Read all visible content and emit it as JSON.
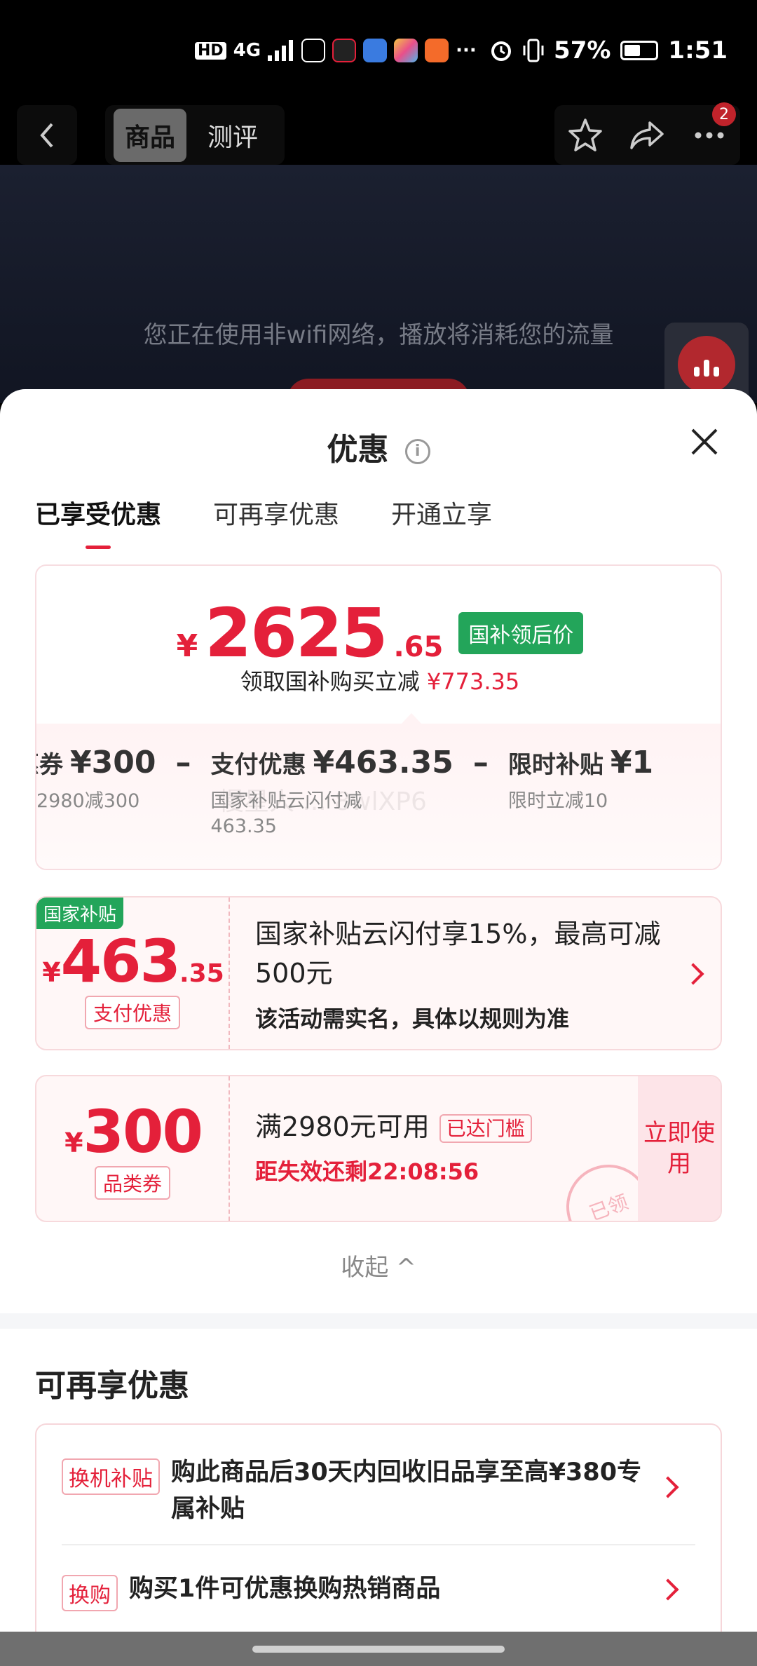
{
  "status_bar": {
    "hd": "HD",
    "net": "4G",
    "more": "···",
    "battery": "57%",
    "battery_level": 0.57,
    "time": "1:51"
  },
  "top_nav": {
    "tabs": [
      {
        "label": "商品"
      },
      {
        "label": "测评"
      }
    ],
    "badge": "2"
  },
  "video": {
    "message": "您正在使用非wifi网络，播放将消耗您的流量"
  },
  "sheet": {
    "title": "优惠",
    "info": "i",
    "tabs": [
      {
        "label": "已享受优惠"
      },
      {
        "label": "可再享优惠"
      },
      {
        "label": "开通立享"
      }
    ],
    "summary": {
      "currency": "¥",
      "price_int": "2625",
      "price_dec": ".65",
      "tag": "国补领后价",
      "claim_text": "领取国补购买立减",
      "claim_amount": "¥773.35",
      "breakdown": [
        {
          "label": "惠券",
          "value": "¥300",
          "sub": "2980减300"
        },
        {
          "label": "支付优惠",
          "value": "¥463.35",
          "sub": "国家补贴云闪付减\n463.35"
        },
        {
          "label": "限时补贴",
          "value": "¥1",
          "sub": "限时立减10"
        }
      ],
      "minus": "–",
      "watermark": "慢星人 ... 8wlXP6"
    },
    "coupon1": {
      "corner_tag": "国家补贴",
      "currency": "¥",
      "amount_int": "463",
      "amount_dec": ".35",
      "pill": "支付优惠",
      "title": "国家补贴云闪付享15%，最高可减500元",
      "subtitle": "该活动需实名，具体以规则为准"
    },
    "coupon2": {
      "currency": "¥",
      "amount_int": "300",
      "pill": "品类券",
      "title": "满2980元可用",
      "reached": "已达门槛",
      "countdown": "距失效还剩22:08:56",
      "use_now": "立即使用",
      "stamp": "已领"
    },
    "collapse": "收起 ^",
    "more_section": {
      "title": "可再享优惠",
      "items": [
        {
          "tag": "换机补贴",
          "text": "购此商品后30天内回收旧品享至高¥380专属补贴"
        },
        {
          "tag": "换购",
          "text": "购买1件可优惠换购热销商品"
        }
      ]
    }
  },
  "colors": {
    "accent_red": "#e4203a",
    "green_tag": "#23a55a",
    "pink_bg": "#fff7f7"
  }
}
